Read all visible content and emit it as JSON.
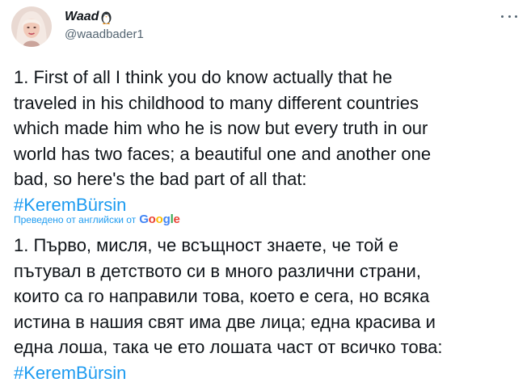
{
  "author": {
    "display_name": "Waad",
    "handle": "@waadbader1",
    "avatar": "avatar-image",
    "name_emoji": "penguin-emoji"
  },
  "menu": {
    "icon": "more-icon"
  },
  "tweet": {
    "lines": [
      "1. First of all I think you do know actually that he",
      "traveled in his childhood to many different countries",
      "which made him who he is now but every truth in our",
      "world has two faces; a beautiful one and another one",
      "bad, so here's the bad part of all that:"
    ],
    "hashtag": "#KeremBürsin"
  },
  "translation_attribution": {
    "label": "Преведено от английски от",
    "provider": "Google"
  },
  "translation": {
    "lines": [
      "1. Първо, мисля, че всъщност знаете, че той е",
      "пътувал в детството си в много различни страни,",
      "които са го направили това, което е сега, но всяка",
      "истина в нашия свят има две лица; една красива и",
      "една лоша, така че ето лошата част от всичко това:"
    ],
    "hashtag": "#KeremBürsin"
  },
  "colors": {
    "link": "#1d9bf0",
    "text": "#0f1419",
    "secondary": "#536471"
  }
}
